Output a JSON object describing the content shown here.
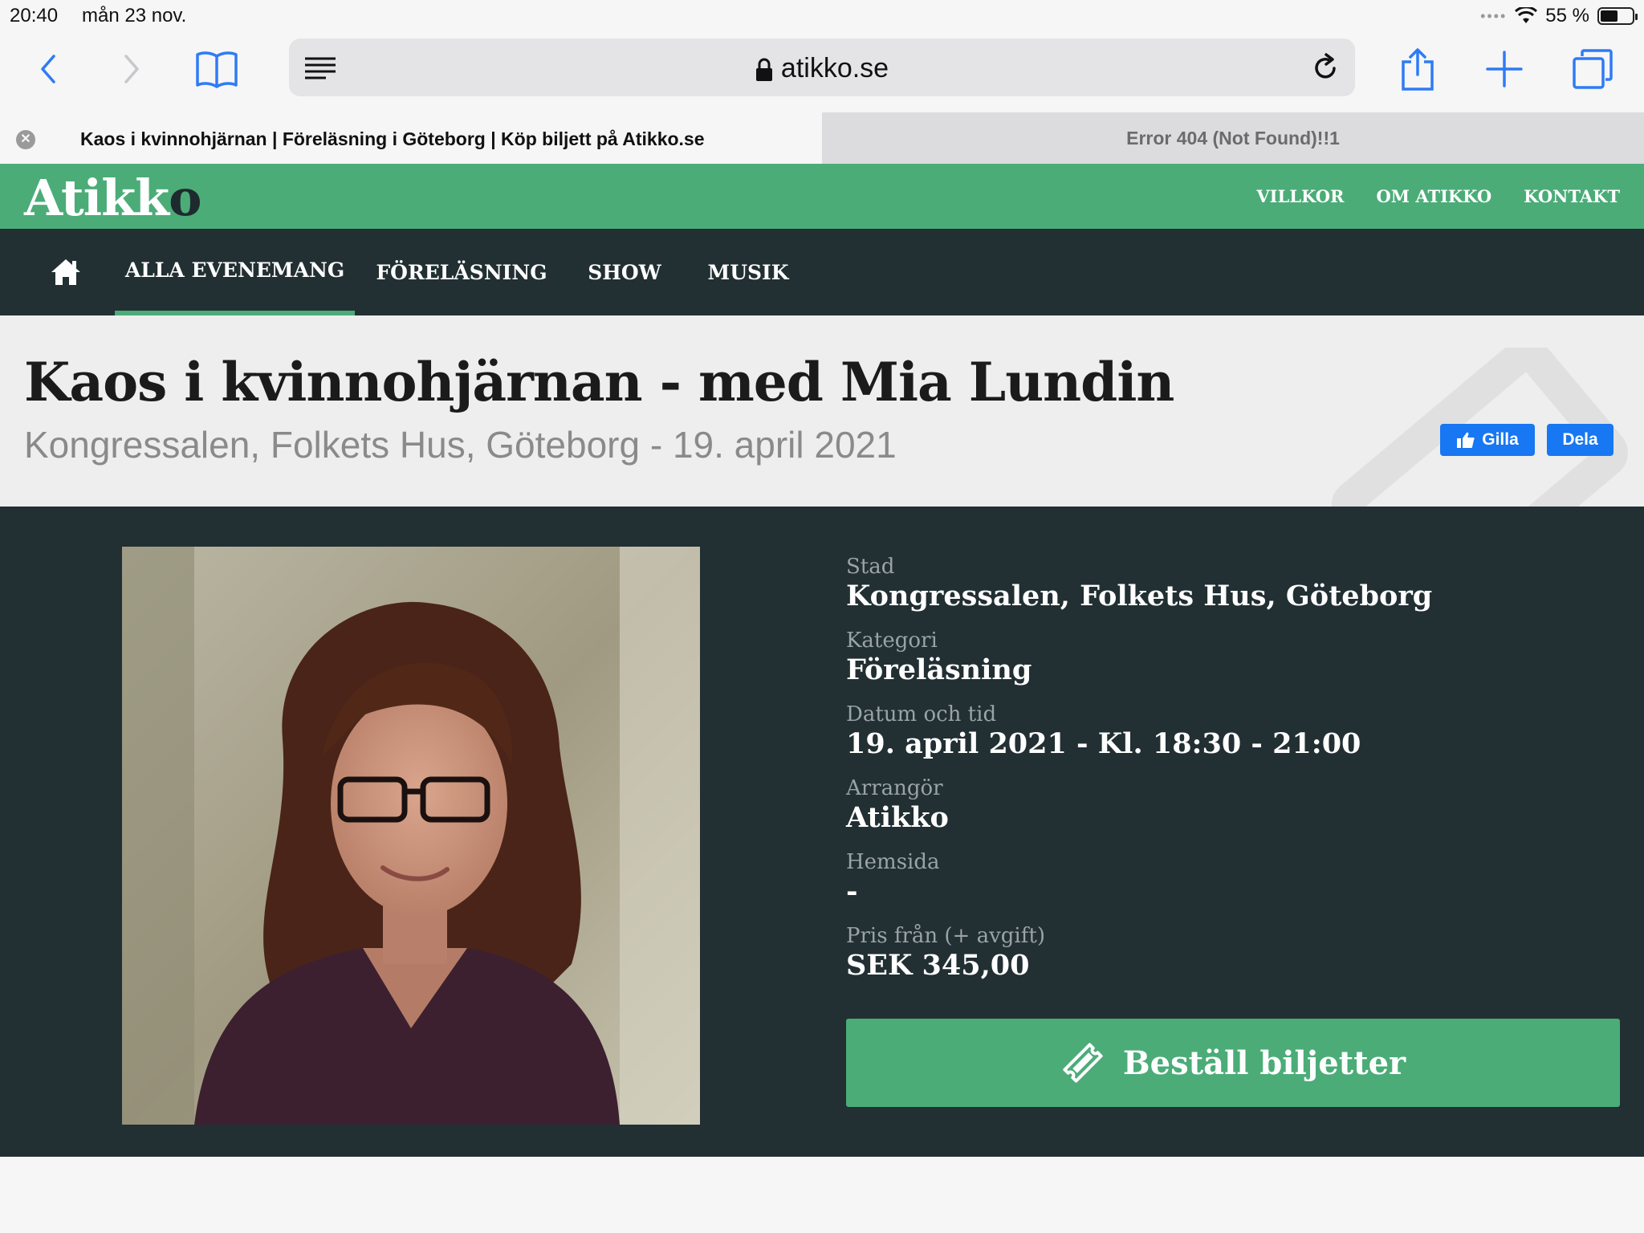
{
  "status_bar": {
    "time": "20:40",
    "date": "mån 23 nov.",
    "battery": "55 %",
    "battery_level": 0.55
  },
  "browser": {
    "url": "atikko.se",
    "icons": [
      "back-icon",
      "forward-icon",
      "bookmarks-icon",
      "reader-icon",
      "lock-icon",
      "reload-icon",
      "share-icon",
      "new-tab-icon",
      "tabs-icon"
    ],
    "tabs": [
      {
        "title": "Kaos i kvinnohjärnan | Föreläsning i Göteborg | Köp biljett på Atikko.se",
        "active": true
      },
      {
        "title": "Error 404 (Not Found)!!1",
        "active": false
      }
    ]
  },
  "site": {
    "logo": "Atikko",
    "brand_color": "#4bac78",
    "dark_color": "#222f33",
    "top_links": [
      "VILLKOR",
      "OM ATIKKO",
      "KONTAKT"
    ],
    "categories": [
      {
        "label": "ALLA EVENEMANG",
        "active": true
      },
      {
        "label": "FÖRELÄSNING",
        "active": false
      },
      {
        "label": "SHOW",
        "active": false
      },
      {
        "label": "MUSIK",
        "active": false
      }
    ]
  },
  "event": {
    "title": "Kaos i kvinnohjärnan - med Mia Lundin",
    "subtitle": "Kongressalen, Folkets Hus, Göteborg - 19. april 2021",
    "social": {
      "like": "Gilla",
      "share": "Dela"
    },
    "details": [
      {
        "label": "Stad",
        "value": "Kongressalen, Folkets Hus, Göteborg"
      },
      {
        "label": "Kategori",
        "value": "Föreläsning"
      },
      {
        "label": "Datum och tid",
        "value": "19. april 2021 - Kl. 18:30 - 21:00"
      },
      {
        "label": "Arrangör",
        "value": "Atikko"
      },
      {
        "label": "Hemsida",
        "value": "-"
      },
      {
        "label": "Pris från (+ avgift)",
        "value": "SEK 345,00"
      }
    ],
    "order_button": "Beställ biljetter"
  }
}
